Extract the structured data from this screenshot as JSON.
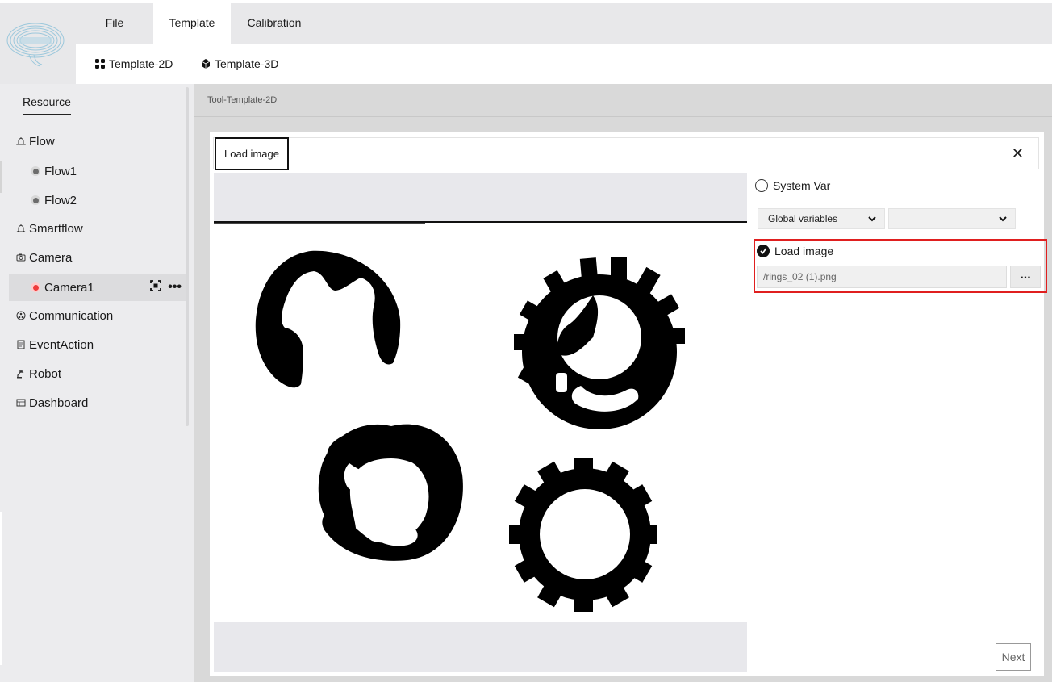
{
  "top_menu": {
    "tabs": [
      {
        "label": "File"
      },
      {
        "label": "Template",
        "active": true
      },
      {
        "label": "Calibration"
      }
    ]
  },
  "sub_menu": {
    "items": [
      {
        "label": "Template-2D",
        "icon": "grid-icon"
      },
      {
        "label": "Template-3D",
        "icon": "cube-icon"
      }
    ]
  },
  "sidebar": {
    "tab": "Resource",
    "items": [
      {
        "label": "Flow",
        "icon": "bell-icon"
      },
      {
        "label": "Flow1",
        "status": "idle"
      },
      {
        "label": "Flow2",
        "status": "idle"
      },
      {
        "label": "Smartflow",
        "icon": "bell-icon"
      },
      {
        "label": "Camera",
        "icon": "camera-icon"
      },
      {
        "label": "Camera1",
        "status": "error",
        "selected": true
      },
      {
        "label": "Communication",
        "icon": "network-icon"
      },
      {
        "label": "EventAction",
        "icon": "document-icon"
      },
      {
        "label": "Robot",
        "icon": "robot-icon"
      },
      {
        "label": "Dashboard",
        "icon": "dashboard-icon"
      }
    ],
    "more_label": "•••"
  },
  "main": {
    "breadcrumb": "Tool-Template-2D",
    "panel": {
      "tab_label": "Load image",
      "close_label": "✕",
      "system_var_label": "System Var",
      "global_select": "Global variables",
      "second_select": "",
      "load_image_label": "Load image",
      "file_path": "/rings_02 (1).png",
      "browse_label": "...",
      "next_label": "Next"
    }
  },
  "colors": {
    "highlight_border": "#e01f1f",
    "error_dot": "#ef3b3b",
    "background": "#e8e8ea"
  }
}
